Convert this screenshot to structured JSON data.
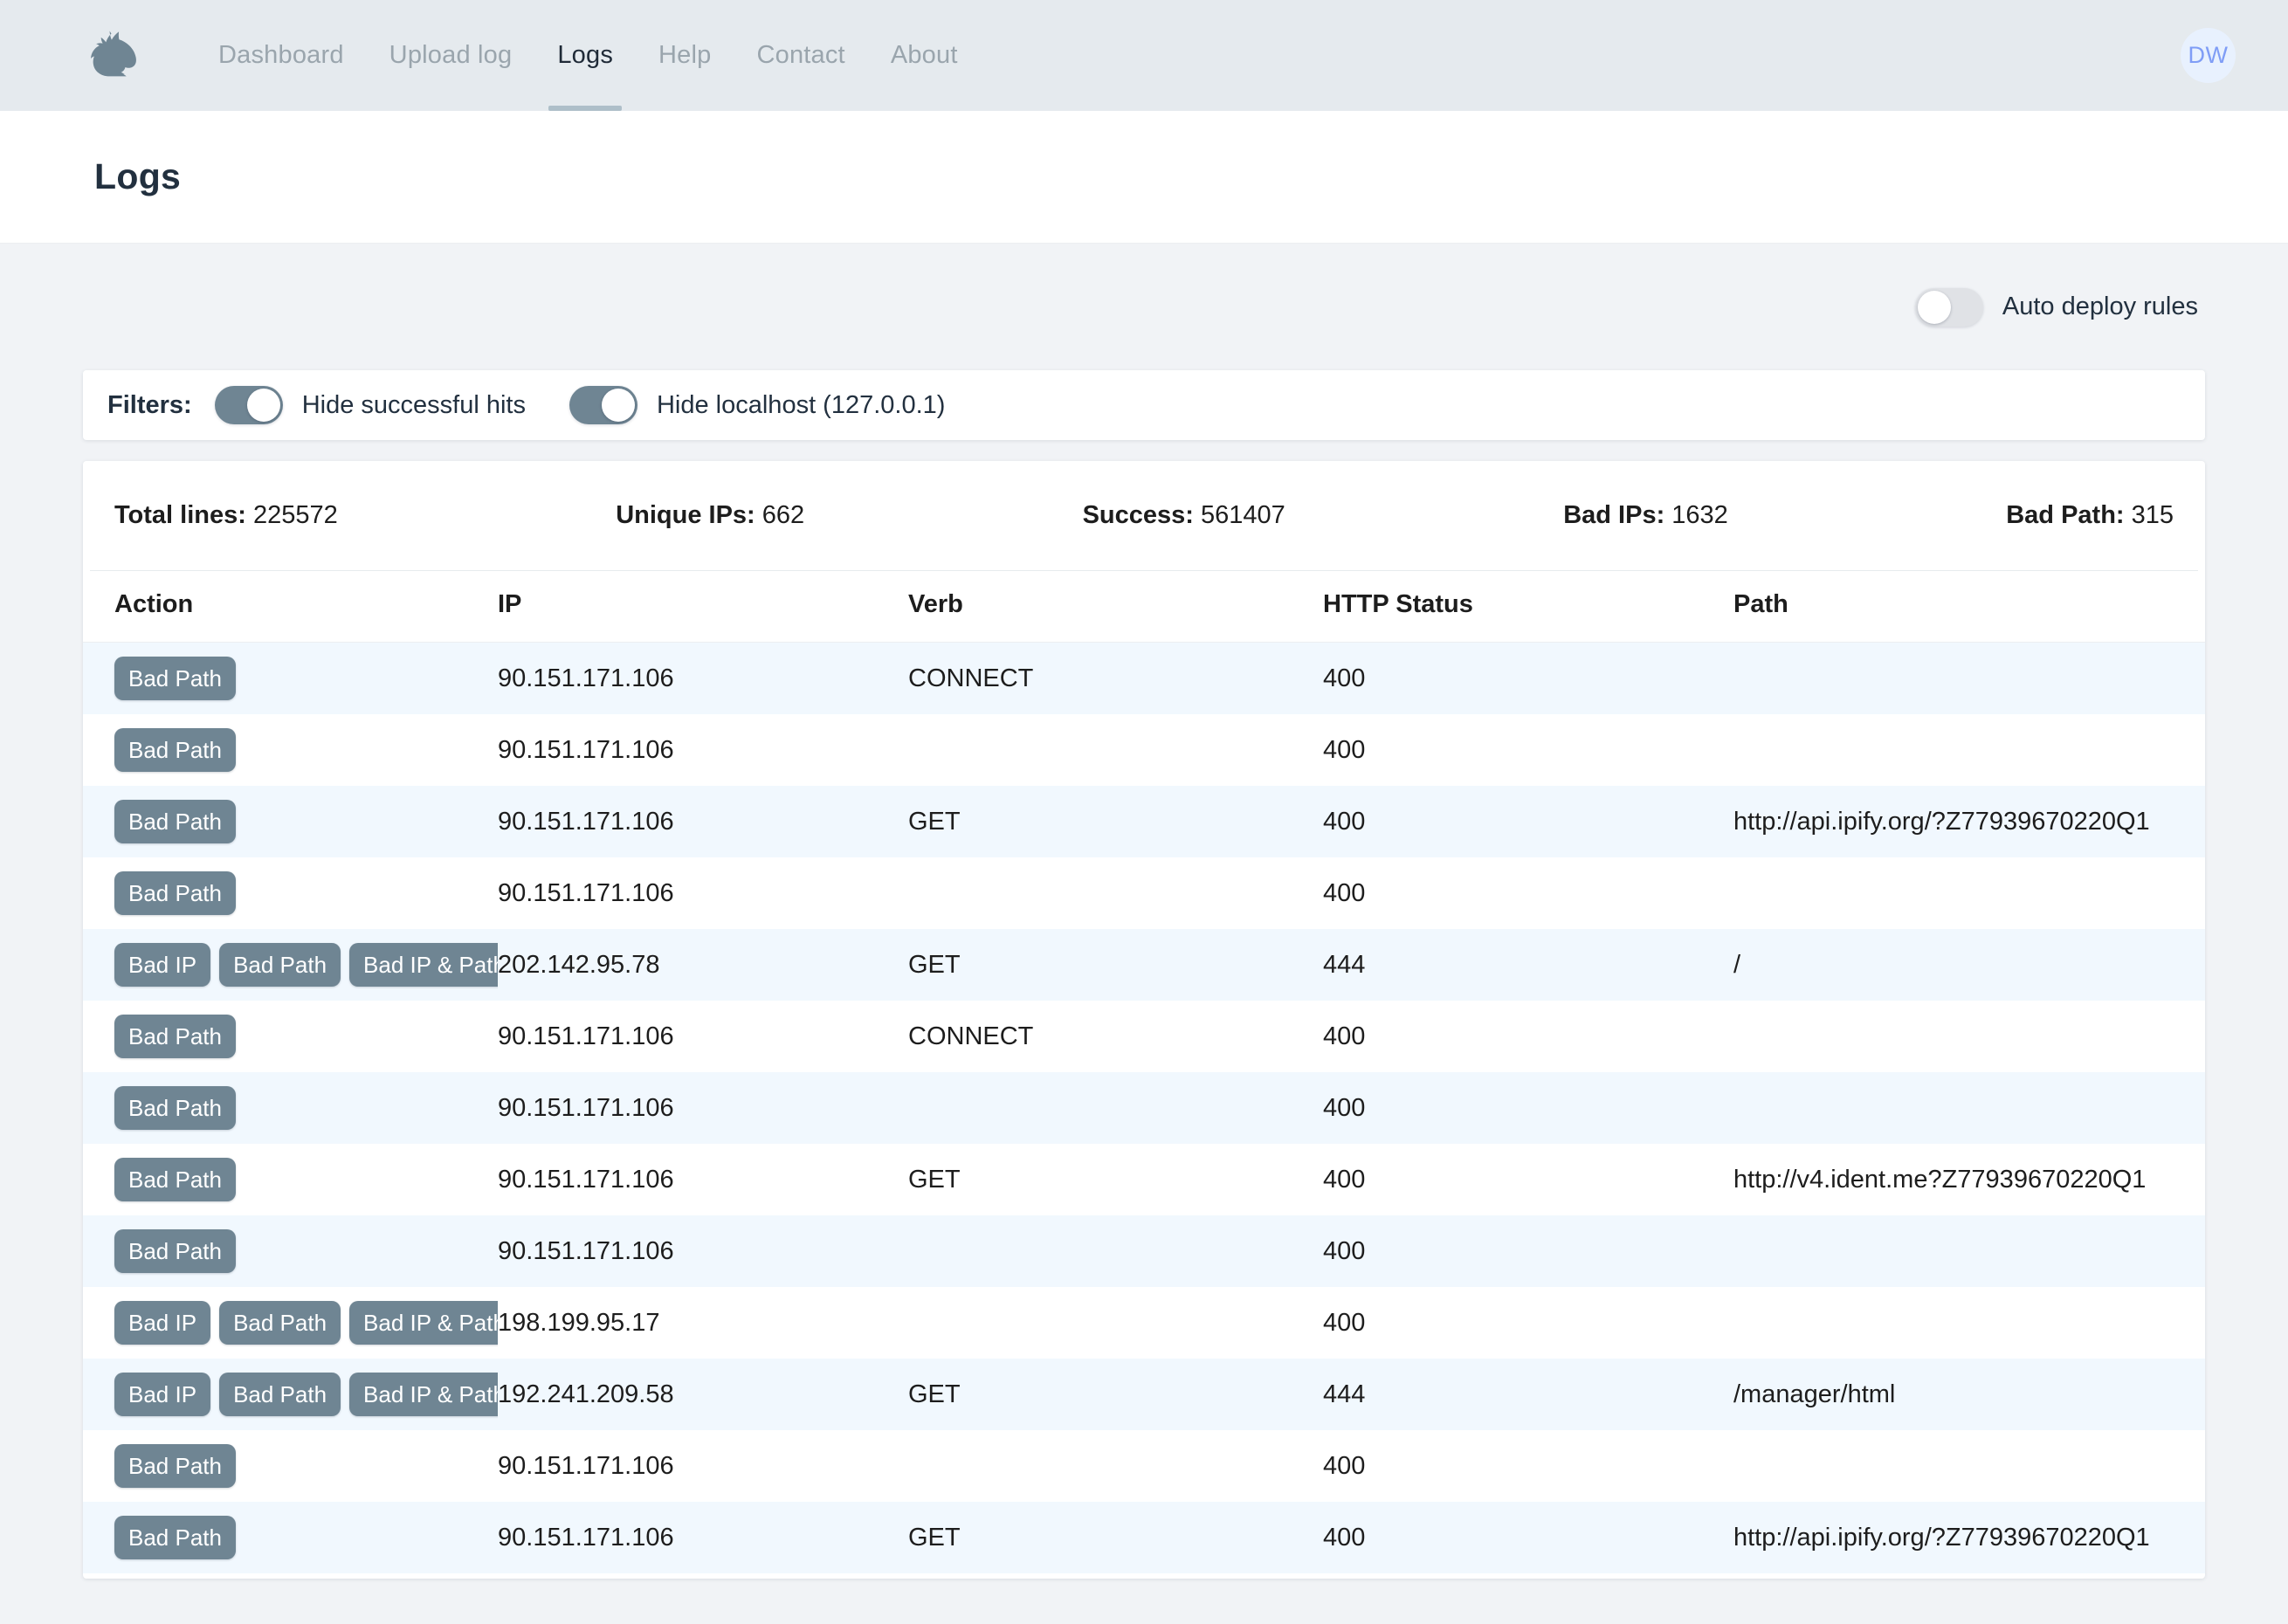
{
  "brand": {
    "logo_icon": "wolf-head-icon",
    "accent_color": "#6f8593",
    "stripe_color": "#f1f8fe"
  },
  "nav": {
    "items": [
      {
        "label": "Dashboard",
        "active": false
      },
      {
        "label": "Upload log",
        "active": false
      },
      {
        "label": "Logs",
        "active": true
      },
      {
        "label": "Help",
        "active": false
      },
      {
        "label": "Contact",
        "active": false
      },
      {
        "label": "About",
        "active": false
      }
    ],
    "avatar_initials": "DW"
  },
  "header": {
    "title": "Logs"
  },
  "auto_deploy": {
    "label": "Auto deploy rules",
    "state": "off"
  },
  "filters": {
    "label": "Filters:",
    "items": [
      {
        "label": "Hide successful hits",
        "state": "on"
      },
      {
        "label": "Hide localhost (127.0.0.1)",
        "state": "on"
      }
    ]
  },
  "stats": [
    {
      "label": "Total lines:",
      "value": "225572"
    },
    {
      "label": "Unique IPs:",
      "value": "662"
    },
    {
      "label": "Success:",
      "value": "561407"
    },
    {
      "label": "Bad IPs:",
      "value": "1632"
    },
    {
      "label": "Bad Path:",
      "value": "315"
    }
  ],
  "table": {
    "columns": [
      "Action",
      "IP",
      "Verb",
      "HTTP Status",
      "Path"
    ],
    "rows": [
      {
        "actions": [
          "Bad Path"
        ],
        "ip": "90.151.171.106",
        "verb": "CONNECT",
        "status": "400",
        "path": ""
      },
      {
        "actions": [
          "Bad Path"
        ],
        "ip": "90.151.171.106",
        "verb": "",
        "status": "400",
        "path": ""
      },
      {
        "actions": [
          "Bad Path"
        ],
        "ip": "90.151.171.106",
        "verb": "GET",
        "status": "400",
        "path": "http://api.ipify.org/?Z77939670220Q1"
      },
      {
        "actions": [
          "Bad Path"
        ],
        "ip": "90.151.171.106",
        "verb": "",
        "status": "400",
        "path": ""
      },
      {
        "actions": [
          "Bad IP",
          "Bad Path",
          "Bad IP & Path"
        ],
        "ip": "202.142.95.78",
        "verb": "GET",
        "status": "444",
        "path": "/"
      },
      {
        "actions": [
          "Bad Path"
        ],
        "ip": "90.151.171.106",
        "verb": "CONNECT",
        "status": "400",
        "path": ""
      },
      {
        "actions": [
          "Bad Path"
        ],
        "ip": "90.151.171.106",
        "verb": "",
        "status": "400",
        "path": ""
      },
      {
        "actions": [
          "Bad Path"
        ],
        "ip": "90.151.171.106",
        "verb": "GET",
        "status": "400",
        "path": "http://v4.ident.me?Z77939670220Q1"
      },
      {
        "actions": [
          "Bad Path"
        ],
        "ip": "90.151.171.106",
        "verb": "",
        "status": "400",
        "path": ""
      },
      {
        "actions": [
          "Bad IP",
          "Bad Path",
          "Bad IP & Path"
        ],
        "ip": "198.199.95.17",
        "verb": "",
        "status": "400",
        "path": ""
      },
      {
        "actions": [
          "Bad IP",
          "Bad Path",
          "Bad IP & Path"
        ],
        "ip": "192.241.209.58",
        "verb": "GET",
        "status": "444",
        "path": "/manager/html"
      },
      {
        "actions": [
          "Bad Path"
        ],
        "ip": "90.151.171.106",
        "verb": "",
        "status": "400",
        "path": ""
      },
      {
        "actions": [
          "Bad Path"
        ],
        "ip": "90.151.171.106",
        "verb": "GET",
        "status": "400",
        "path": "http://api.ipify.org/?Z77939670220Q1"
      }
    ]
  }
}
